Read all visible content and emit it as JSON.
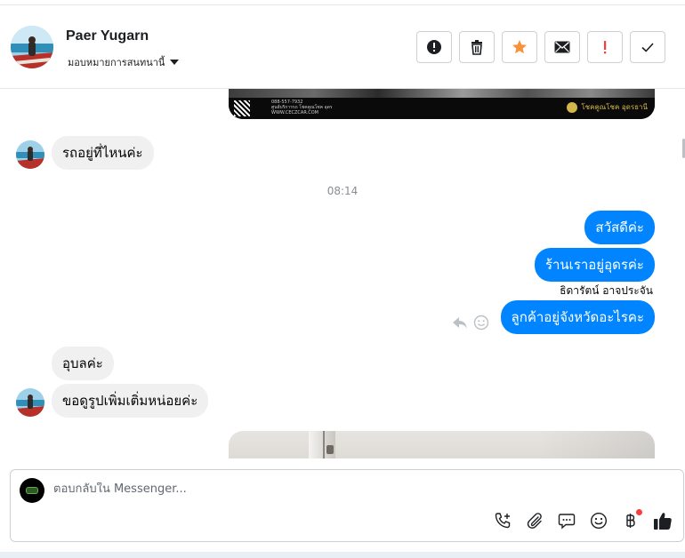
{
  "header": {
    "contact_name": "Paer Yugarn",
    "assign_label": "มอบหมายการสนทนานี้",
    "actions": [
      {
        "name": "mark-spam-button",
        "icon": "alert-circle-icon"
      },
      {
        "name": "delete-button",
        "icon": "trash-icon"
      },
      {
        "name": "follow-up-button",
        "icon": "star-icon"
      },
      {
        "name": "mark-unread-button",
        "icon": "envelope-icon"
      },
      {
        "name": "important-button",
        "icon": "exclamation-icon"
      },
      {
        "name": "mark-done-button",
        "icon": "check-icon"
      }
    ]
  },
  "conversation": {
    "image_top": {
      "phone_lines": [
        "088-557-7932",
        "ศูนย์บริการรถ โชคคูณโชค อุดร",
        "WWW.CECZCAR.COM"
      ],
      "brand": "โชคคูณโชค อุดรธานี"
    },
    "messages": [
      {
        "direction": "in",
        "text": "รถอยู่ที่ไหนค่ะ"
      },
      {
        "direction": "out",
        "text": "สวัสดีค่ะ"
      },
      {
        "direction": "out",
        "text": "ร้านเราอยู่อุดรค่ะ"
      },
      {
        "direction": "out",
        "text": "ลูกค้าอยู่จังหวัดอะไรคะ"
      },
      {
        "direction": "in",
        "text": "อุบลค่ะ"
      },
      {
        "direction": "in",
        "text": "ขอดูรูปเพิ่มเติ่มหน่อยค่ะ"
      }
    ],
    "timestamp": "08:14",
    "sender_label": "ธิดารัตน์ อาจประจัน"
  },
  "composer": {
    "placeholder": "ตอบกลับใน Messenger..."
  },
  "colors": {
    "accent": "#0084ff",
    "incoming_bubble": "#f0f0f0",
    "star": "#f7923a",
    "alert": "#fa3e3e"
  }
}
